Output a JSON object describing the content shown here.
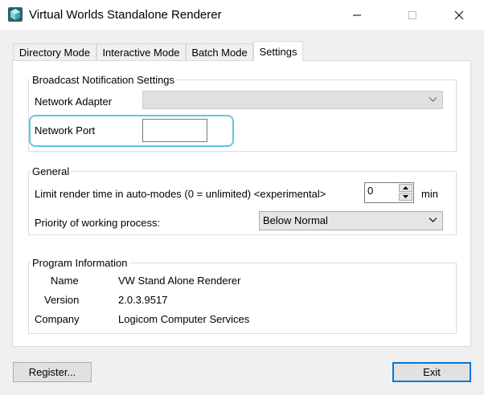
{
  "window": {
    "title": "Virtual Worlds Standalone Renderer",
    "minimize_icon": "minimize-icon",
    "maximize_icon": "maximize-icon",
    "close_icon": "close-icon"
  },
  "tabs": [
    {
      "label": "Directory Mode",
      "active": false
    },
    {
      "label": "Interactive Mode",
      "active": false
    },
    {
      "label": "Batch Mode",
      "active": false
    },
    {
      "label": "Settings",
      "active": true
    }
  ],
  "broadcast": {
    "group_title": "Broadcast Notification Settings",
    "adapter_label": "Network Adapter",
    "adapter_value": "",
    "port_label": "Network Port",
    "port_value": ""
  },
  "general": {
    "group_title": "General",
    "limit_label": "Limit render time in auto-modes (0 = unlimited) <experimental>",
    "limit_value": "0",
    "limit_unit": "min",
    "priority_label": "Priority of working process:",
    "priority_value": "Below Normal"
  },
  "program_info": {
    "group_title": "Program Information",
    "rows": [
      {
        "label": "Name",
        "value": "VW Stand Alone Renderer"
      },
      {
        "label": "Version",
        "value": "2.0.3.9517"
      },
      {
        "label": "Company",
        "value": "Logicom Computer Services"
      }
    ]
  },
  "buttons": {
    "register": "Register...",
    "exit": "Exit"
  },
  "colors": {
    "highlight": "#5fc6e6",
    "default_button_border": "#0078d7"
  }
}
